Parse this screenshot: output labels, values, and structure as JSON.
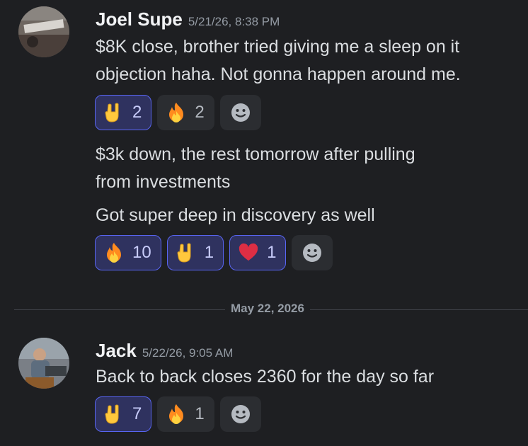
{
  "messages": [
    {
      "author": "Joel Supe",
      "timestamp": "5/21/26, 8:38 PM",
      "lines": [
        "$8K close, brother tried giving me a sleep on it",
        "objection haha. Not gonna happen around me."
      ],
      "reactions": [
        {
          "emoji": "rock-on-hand",
          "count": "2",
          "selected": true
        },
        {
          "emoji": "fire",
          "count": "2",
          "selected": false
        }
      ]
    },
    {
      "lines": [
        "$3k down, the rest tomorrow after pulling",
        "from investments"
      ]
    },
    {
      "lines": [
        "Got super deep in discovery as well"
      ],
      "reactions": [
        {
          "emoji": "fire",
          "count": "10",
          "selected": true
        },
        {
          "emoji": "rock-on-hand",
          "count": "1",
          "selected": true
        },
        {
          "emoji": "red-heart",
          "count": "1",
          "selected": true
        }
      ]
    },
    {
      "author": "Jack",
      "timestamp": "5/22/26, 9:05 AM",
      "lines": [
        "Back to back closes 2360 for the day so far"
      ],
      "reactions": [
        {
          "emoji": "rock-on-hand",
          "count": "7",
          "selected": true
        },
        {
          "emoji": "fire",
          "count": "1",
          "selected": false
        }
      ]
    }
  ],
  "date_divider": "May 22, 2026",
  "colors": {
    "background": "#1e1f22",
    "reaction_selected_bg": "#2f325f",
    "reaction_selected_border": "#5865f2",
    "reaction_bg": "#2b2d31"
  }
}
